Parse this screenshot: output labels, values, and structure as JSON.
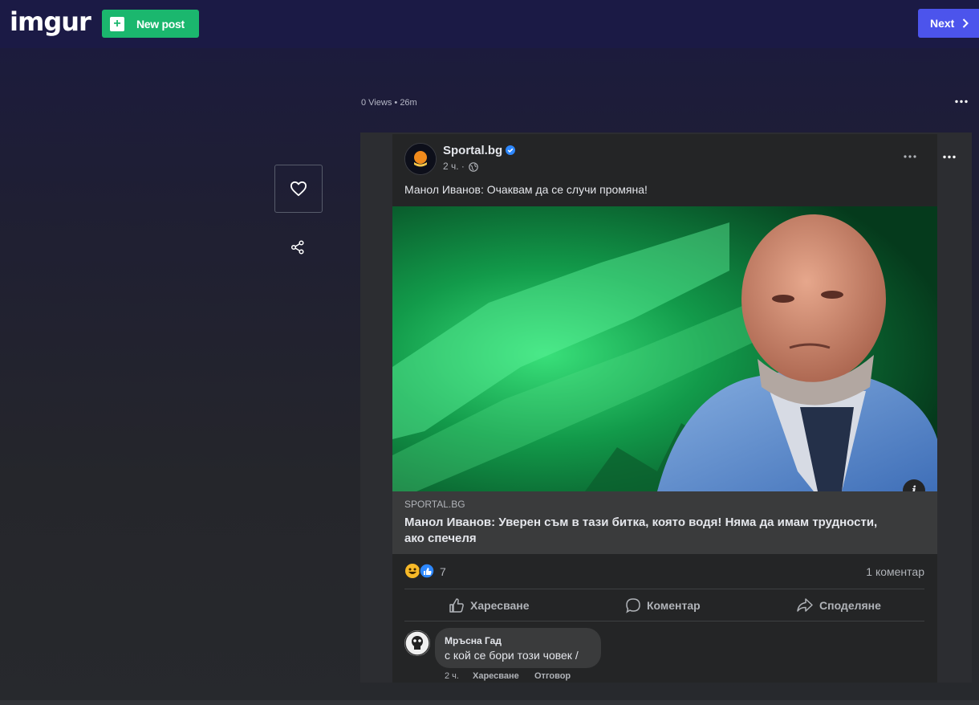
{
  "header": {
    "logo": "imgur",
    "new_post_label": "New post",
    "next_label": "Next"
  },
  "post_meta": {
    "views": "0 Views",
    "separator": "•",
    "age": "26m"
  },
  "icons": {
    "like": "heart-icon",
    "share": "share-icon",
    "options": "more-dots-icon"
  },
  "fb_post": {
    "page_name": "Sportal.bg",
    "time": "2 ч. ·",
    "caption": "Манол Иванов: Очаквам да се случи промяна!",
    "link_domain": "SPORTAL.BG",
    "link_title": "Манол Иванов: Уверен съм в тази битка, която водя! Няма да имам трудности, ако спечеля",
    "reaction_count": "7",
    "comment_count": "1 коментар",
    "actions": {
      "like": "Харесване",
      "comment": "Коментар",
      "share": "Споделяне"
    },
    "comment": {
      "author": "Мръсна Гад",
      "text": "с кой се бори този човек /",
      "time": "2 ч.",
      "like": "Харесване",
      "reply": "Отговор"
    },
    "colors": {
      "brand_green": "#1bb76e",
      "next_blue": "#4c54ec",
      "fb_blue": "#2d88ff"
    }
  }
}
